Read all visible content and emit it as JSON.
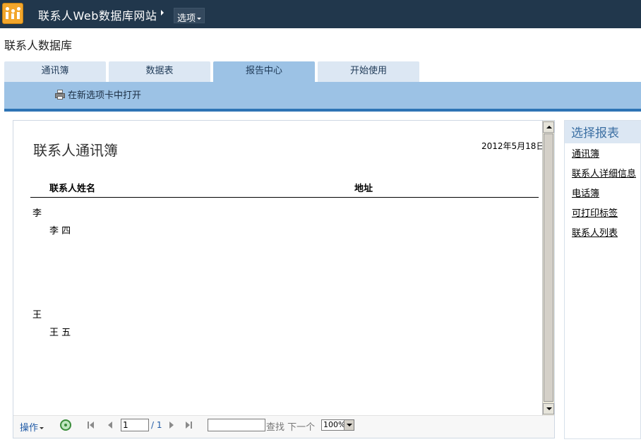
{
  "app": {
    "site_title": "联系人Web数据库网站",
    "options_label": "选项",
    "db_title": "联系人数据库"
  },
  "tabs": [
    {
      "label": "通讯簿",
      "active": false
    },
    {
      "label": "数据表",
      "active": false
    },
    {
      "label": "报告中心",
      "active": true
    },
    {
      "label": "开始使用",
      "active": false
    }
  ],
  "ribbon": {
    "open_new_tab_label": "在新选项卡中打开"
  },
  "report": {
    "title": "联系人通讯簿",
    "date": "2012年5月18日",
    "columns": {
      "name": "联系人姓名",
      "address": "地址"
    },
    "groups": [
      {
        "letter": "李",
        "entries": [
          "李 四"
        ]
      },
      {
        "letter": "王",
        "entries": [
          "王 五"
        ]
      }
    ]
  },
  "toolbar": {
    "actions_label": "操作",
    "page_value": "1",
    "page_total": "/ 1",
    "find_next_label": "查找 下一个",
    "zoom_value": "100%"
  },
  "sidebar": {
    "title": "选择报表",
    "links": [
      "通讯簿",
      "联系人详细信息",
      "电话簿",
      "可打印标签",
      "联系人列表"
    ]
  },
  "colors": {
    "topbar": "#21374c",
    "ribbon": "#9cc2e5",
    "accent_line": "#2e74b5",
    "tab_inactive": "#dce7f3"
  }
}
